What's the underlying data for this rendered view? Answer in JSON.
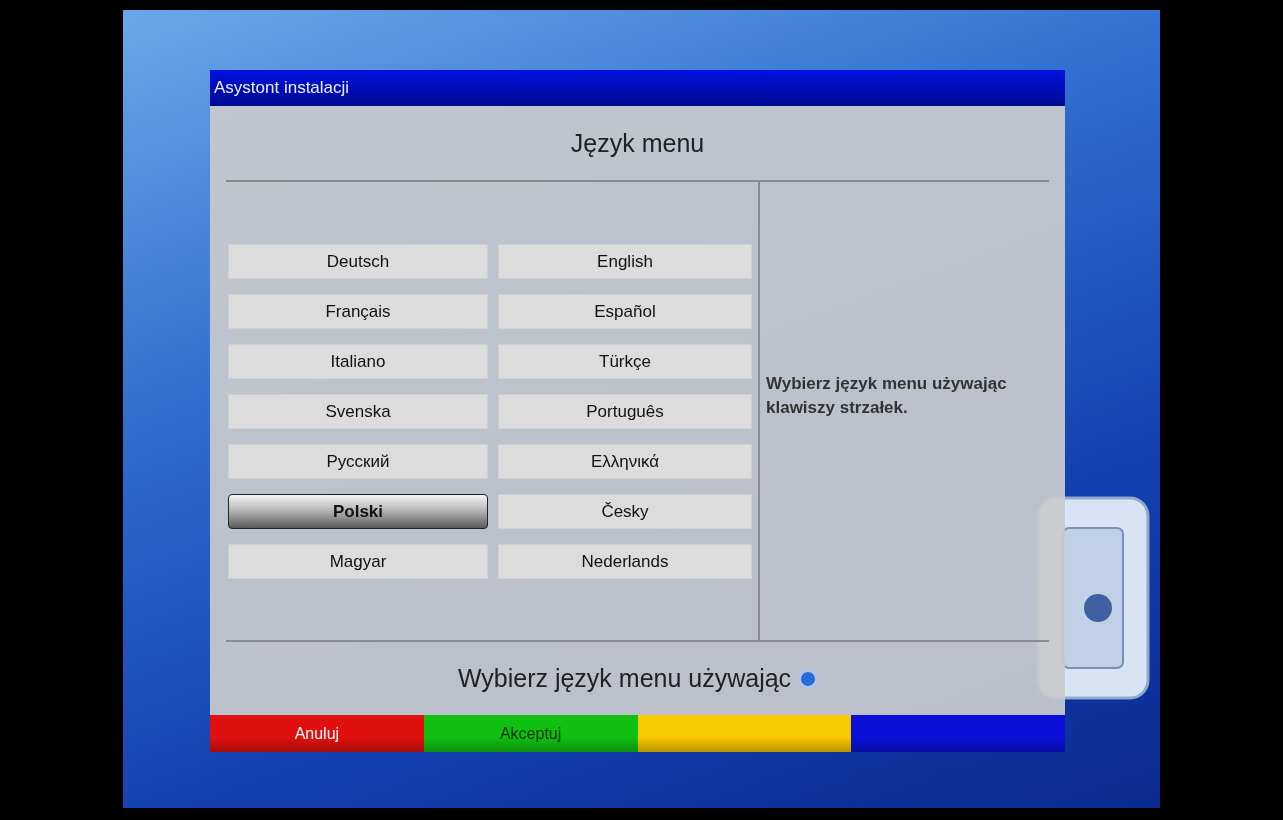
{
  "window": {
    "title": "Asystont instalacji"
  },
  "heading": "Język menu",
  "languages": [
    {
      "label": "Deutsch",
      "selected": false
    },
    {
      "label": "English",
      "selected": false
    },
    {
      "label": "Français",
      "selected": false
    },
    {
      "label": "Español",
      "selected": false
    },
    {
      "label": "Italiano",
      "selected": false
    },
    {
      "label": "Türkçe",
      "selected": false
    },
    {
      "label": "Svenska",
      "selected": false
    },
    {
      "label": "Português",
      "selected": false
    },
    {
      "label": "Русский",
      "selected": false
    },
    {
      "label": "Ελληνικά",
      "selected": false
    },
    {
      "label": "Polski",
      "selected": true
    },
    {
      "label": "Česky",
      "selected": false
    },
    {
      "label": "Magyar",
      "selected": false
    },
    {
      "label": "Nederlands",
      "selected": false
    }
  ],
  "help_text": "Wybierz język menu używając klawiszy strzałek.",
  "hint": {
    "text": "Wybierz język menu używając"
  },
  "buttons": [
    {
      "label": "Anuluj",
      "color": "#e01010"
    },
    {
      "label": "Akceptuj",
      "color": "#10c010"
    },
    {
      "color": "#f8c800"
    },
    {
      "color": "#0a10d8"
    }
  ]
}
